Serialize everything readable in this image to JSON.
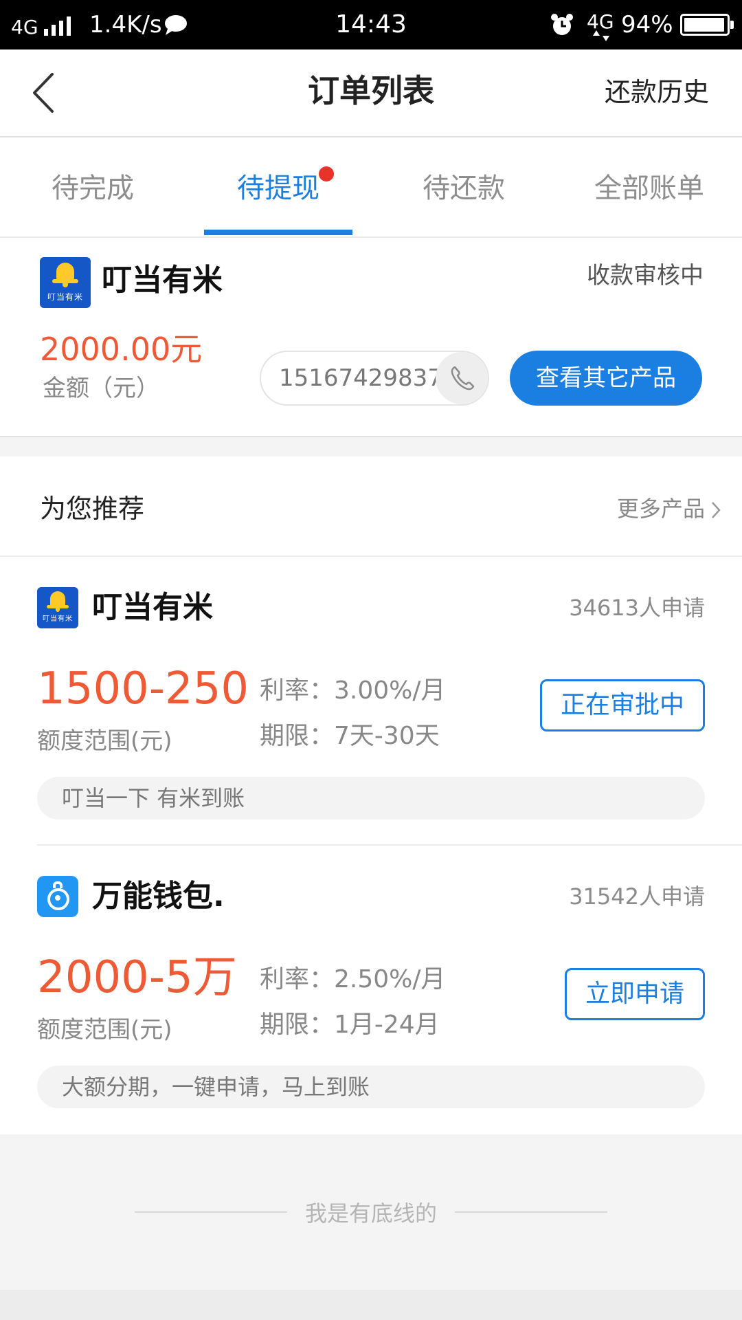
{
  "status_bar": {
    "network": "4G",
    "speed": "1.4K/s",
    "time": "14:43",
    "network_right": "4G",
    "battery": "94%"
  },
  "header": {
    "title": "订单列表",
    "right_link": "还款历史"
  },
  "tabs": [
    {
      "label": "待完成",
      "active": false
    },
    {
      "label": "待提现",
      "active": true,
      "badge": true
    },
    {
      "label": "待还款",
      "active": false
    },
    {
      "label": "全部账单",
      "active": false
    }
  ],
  "order": {
    "product_name": "叮当有米",
    "logo_caption": "叮当有米",
    "status": "收款审核中",
    "amount": "2000.00元",
    "amount_label": "金额（元）",
    "phone": "15167429837",
    "button": "查看其它产品"
  },
  "recommend": {
    "title": "为您推荐",
    "more": "更多产品",
    "products": [
      {
        "name": "叮当有米",
        "logo_caption": "叮当有米",
        "applicants": "34613人申请",
        "range": "1500-250",
        "range_label": "额度范围(元)",
        "rate": "利率：3.00%/月",
        "term": "期限：7天-30天",
        "button": "正在审批中",
        "slogan": "叮当一下  有米到账"
      },
      {
        "name": "万能钱包.",
        "applicants": "31542人申请",
        "range": "2000-5万",
        "range_label": "额度范围(元)",
        "rate": "利率：2.50%/月",
        "term": "期限：1月-24月",
        "button": "立即申请",
        "slogan": "大额分期，一键申请，马上到账"
      }
    ]
  },
  "footer": {
    "text": "我是有底线的"
  },
  "colors": {
    "accent": "#1a7fe0",
    "amount": "#ee5a35",
    "badge": "#e8332b"
  }
}
